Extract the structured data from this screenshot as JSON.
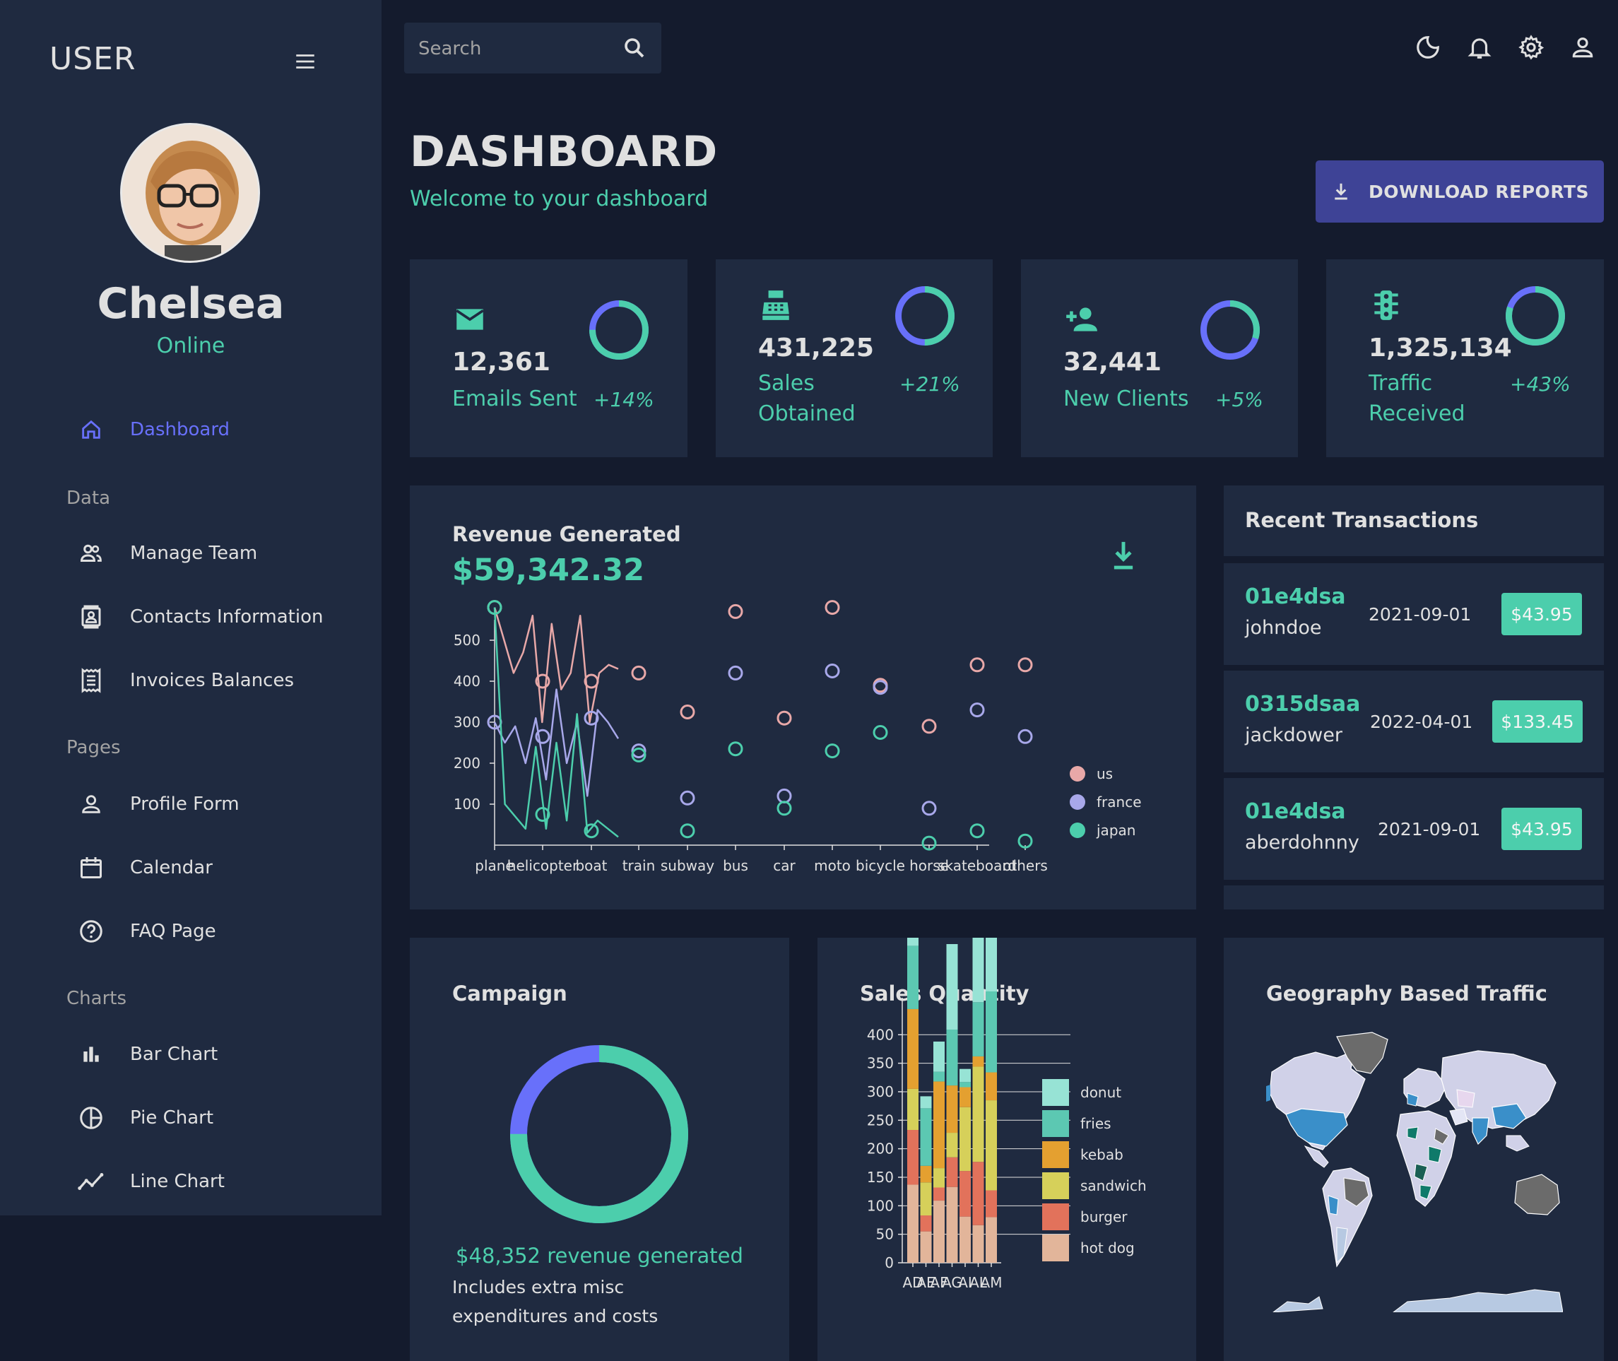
{
  "sidebar": {
    "brand": "USER",
    "user_name": "Chelsea",
    "user_status": "Online",
    "sections": {
      "data": "Data",
      "pages": "Pages",
      "charts": "Charts"
    },
    "items": [
      {
        "label": "Dashboard",
        "icon": "home-icon",
        "active": true
      },
      {
        "label": "Manage Team",
        "icon": "team-icon"
      },
      {
        "label": "Contacts Information",
        "icon": "contacts-icon"
      },
      {
        "label": "Invoices Balances",
        "icon": "receipt-icon"
      },
      {
        "label": "Profile Form",
        "icon": "person-icon"
      },
      {
        "label": "Calendar",
        "icon": "calendar-icon"
      },
      {
        "label": "FAQ Page",
        "icon": "help-icon"
      },
      {
        "label": "Bar Chart",
        "icon": "bar-chart-icon"
      },
      {
        "label": "Pie Chart",
        "icon": "pie-chart-icon"
      },
      {
        "label": "Line Chart",
        "icon": "timeline-icon"
      }
    ]
  },
  "topbar": {
    "search_placeholder": "Search",
    "icons": [
      "dark-mode-icon",
      "notifications-icon",
      "settings-icon",
      "person-icon"
    ]
  },
  "header": {
    "title": "DASHBOARD",
    "subtitle": "Welcome to your dashboard",
    "download_button": "DOWNLOAD REPORTS"
  },
  "stats": [
    {
      "value": "12,361",
      "label": "Emails Sent",
      "increase": "+14%",
      "progress": 0.75,
      "icon": "email-icon"
    },
    {
      "value": "431,225",
      "label": "Sales Obtained",
      "increase": "+21%",
      "progress": 0.5,
      "icon": "point-of-sale-icon"
    },
    {
      "value": "32,441",
      "label": "New Clients",
      "increase": "+5%",
      "progress": 0.3,
      "icon": "person-add-icon"
    },
    {
      "value": "1,325,134",
      "label": "Traffic Received",
      "increase": "+43%",
      "progress": 0.8,
      "icon": "traffic-icon"
    }
  ],
  "revenue": {
    "title": "Revenue Generated",
    "amount": "$59,342.32"
  },
  "transactions": {
    "title": "Recent Transactions",
    "items": [
      {
        "txId": "01e4dsa",
        "user": "johndoe",
        "date": "2021-09-01",
        "cost": "$43.95"
      },
      {
        "txId": "0315dsaa",
        "user": "jackdower",
        "date": "2022-04-01",
        "cost": "$133.45"
      },
      {
        "txId": "01e4dsa",
        "user": "aberdohnny",
        "date": "2021-09-01",
        "cost": "$43.95"
      }
    ]
  },
  "campaign": {
    "title": "Campaign",
    "revenue": "$48,352 revenue generated",
    "note": "Includes extra misc expenditures and costs",
    "progress": 0.75
  },
  "sales_quantity": {
    "title": "Sales Quantity"
  },
  "geography": {
    "title": "Geography Based Traffic"
  },
  "colors": {
    "accent": "#4cceac",
    "primary": "#6870fa",
    "bg": "#141b2d",
    "card": "#1f2a40",
    "button": "#3e4396"
  },
  "chart_data": [
    {
      "type": "line",
      "title": "",
      "categories": [
        "plane",
        "helicopter",
        "boat",
        "train",
        "subway",
        "bus",
        "car",
        "moto",
        "bicycle",
        "horse",
        "skateboard",
        "others"
      ],
      "yticks": [
        100,
        200,
        300,
        400,
        500
      ],
      "ylim": [
        0,
        550
      ],
      "legend_placement": "right",
      "series": [
        {
          "name": "us",
          "color": "#e8a8a8",
          "values": [
            580,
            400,
            400,
            420,
            325,
            570,
            310,
            580,
            390,
            290,
            440,
            440
          ]
        },
        {
          "name": "france",
          "color": "#a8a8ea",
          "values": [
            300,
            265,
            310,
            230,
            115,
            420,
            120,
            425,
            385,
            90,
            330,
            265
          ]
        },
        {
          "name": "japan",
          "color": "#4cceac",
          "values": [
            580,
            75,
            35,
            220,
            35,
            235,
            90,
            230,
            275,
            5,
            35,
            10
          ]
        }
      ]
    },
    {
      "type": "bar",
      "stacked": true,
      "categories": [
        "AD",
        "AE",
        "AF",
        "AG",
        "AI",
        "AL",
        "AM"
      ],
      "yticks": [
        0,
        50,
        100,
        150,
        200,
        250,
        300,
        350,
        400
      ],
      "ylim": [
        0,
        440
      ],
      "legend_placement": "right",
      "series": [
        {
          "name": "hot dog",
          "color": "#e2b59a",
          "values": [
            137,
            55,
            109,
            133,
            81,
            66,
            80
          ]
        },
        {
          "name": "burger",
          "color": "#e2725b",
          "values": [
            96,
            28,
            23,
            52,
            80,
            111,
            47
          ]
        },
        {
          "name": "sandwich",
          "color": "#d6d05a",
          "values": [
            72,
            58,
            34,
            43,
            112,
            167,
            158
          ]
        },
        {
          "name": "kebab",
          "color": "#e4a030",
          "values": [
            140,
            29,
            152,
            83,
            35,
            18,
            49
          ]
        },
        {
          "name": "fries",
          "color": "#5cc8b2",
          "values": [
            111,
            101,
            17,
            98,
            9,
            95,
            142
          ]
        },
        {
          "name": "donut",
          "color": "#97e3d5",
          "values": [
            140,
            21,
            53,
            150,
            23,
            123,
            123
          ]
        }
      ]
    }
  ]
}
